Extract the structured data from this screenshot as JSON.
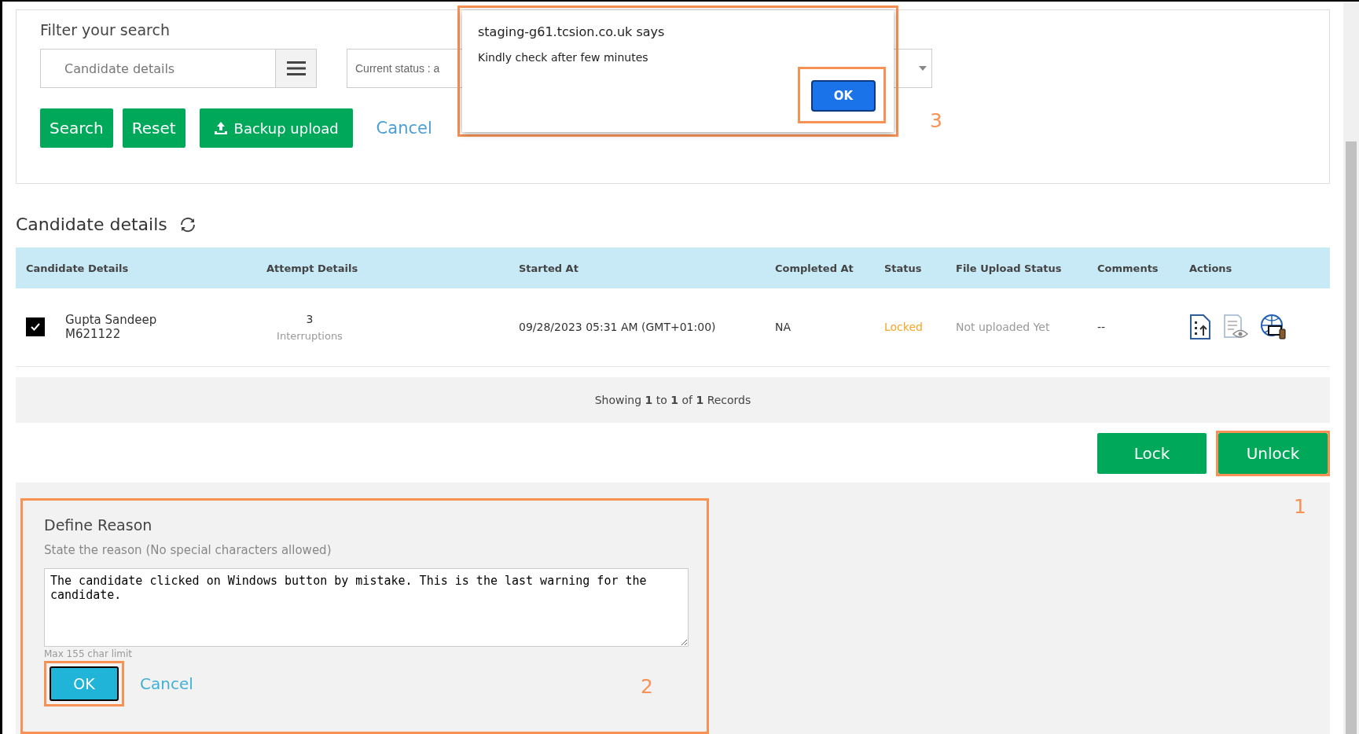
{
  "filter": {
    "title": "Filter your search",
    "candidate_field": {
      "placeholder": "Candidate details"
    },
    "status_dropdown": {
      "value": "Current status : a"
    },
    "buttons": [
      {
        "label": "Search",
        "kind": "primary"
      },
      {
        "label": "Reset",
        "kind": "primary"
      },
      {
        "label": "Backup upload",
        "kind": "upload"
      },
      {
        "label": "Cancel",
        "kind": "link"
      }
    ]
  },
  "dialog": {
    "title": "staging-g61.tcsion.co.uk says",
    "message": "Kindly check after few minutes",
    "ok_button": "OK",
    "ok_highlighted": true,
    "annotation": "3"
  },
  "candidates": {
    "title": "Candidate details",
    "columns": [
      "Candidate Details",
      "Attempt Details",
      "Started At",
      "Completed At",
      "Status",
      "File Upload Status",
      "Comments",
      "Actions"
    ],
    "rows": [
      {
        "checked": true,
        "name": "Gupta Sandeep",
        "id": "M621122",
        "attempts": "3",
        "attempt_label": "Interruptions",
        "started_at": "09/28/2023 05:31 AM (GMT+01:00)",
        "completed_at": "NA",
        "status": "Locked",
        "file_upload_status": "Not uploaded Yet",
        "comments": "--"
      }
    ],
    "footer": "Showing **1** to **1** of **1** Records"
  },
  "actions": [
    {
      "label": "Lock"
    },
    {
      "label": "Unlock",
      "annotation": "1"
    }
  ],
  "reason": {
    "title": "Define Reason",
    "hint": "State the reason (No special characters allowed)",
    "value": "The candidate clicked on Windows button by mistake. This is the last warning for the candidate.",
    "limit": "Max 155 char limit",
    "ok_button": "OK",
    "ok_highlighted": true,
    "cancel": "Cancel",
    "annotation": "2"
  }
}
